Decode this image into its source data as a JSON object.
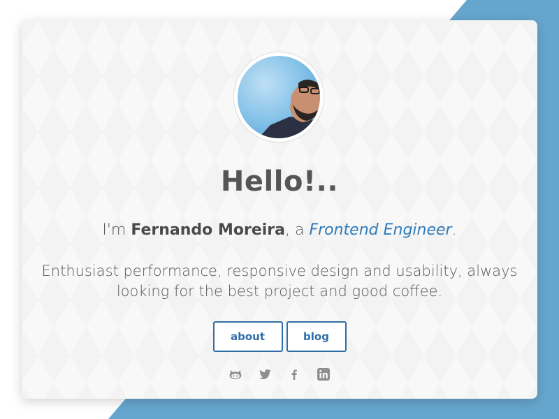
{
  "colors": {
    "accent": "#2f6ea8",
    "link": "#2f7ab8",
    "background_shape": "#66a6ce",
    "card": "#f8f8f8",
    "text": "#555555",
    "icon": "#8f8f8f"
  },
  "profile": {
    "avatar_icon": "profile-photo",
    "greeting": "Hello!..",
    "intro_prefix": "I'm ",
    "name": "Fernando Moreira",
    "intro_middle": ", a ",
    "role": "Frontend Engineer",
    "intro_suffix": ".",
    "bio": "Enthusiast performance, responsive design and usability, always looking for the best project and good coffee."
  },
  "buttons": {
    "about_label": "about",
    "blog_label": "blog"
  },
  "social": [
    {
      "icon": "github-icon"
    },
    {
      "icon": "twitter-icon"
    },
    {
      "icon": "facebook-icon"
    },
    {
      "icon": "linkedin-icon"
    }
  ]
}
